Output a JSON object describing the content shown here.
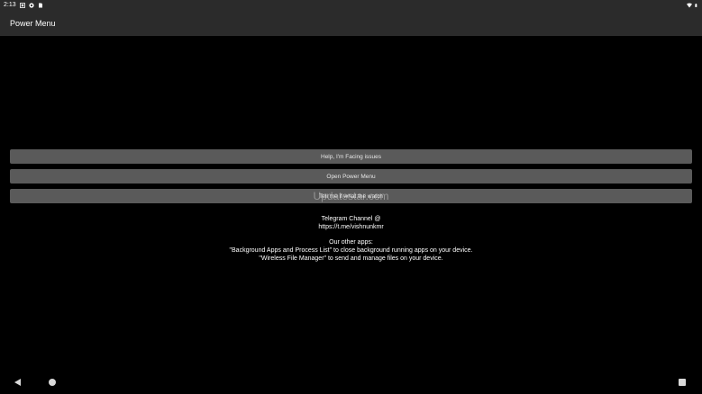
{
  "status_bar": {
    "time": "2:13",
    "icons": [
      "notification-icon",
      "vpn-icon",
      "sd-card-icon",
      "wifi-icon",
      "battery-icon"
    ]
  },
  "app_bar": {
    "title": "Power Menu"
  },
  "buttons": {
    "help": "Help, I'm Facing issues",
    "open_power_menu": "Open Power Menu",
    "third": "Tell me if what the watch"
  },
  "watermark": "Updatestar.com",
  "info": {
    "telegram_title": "Telegram Channel @",
    "telegram_link": "https://t.me/vishnunkmr",
    "other_apps_title": "Our other apps:",
    "app1": "\"Background Apps and Process List\" to close background running apps on your device.",
    "app2": "\"Wireless File Manager\" to send and manage files on your device."
  },
  "colors": {
    "background": "#000000",
    "bar": "#2b2b2b",
    "button": "#5a5a5a",
    "text": "#ffffff"
  }
}
